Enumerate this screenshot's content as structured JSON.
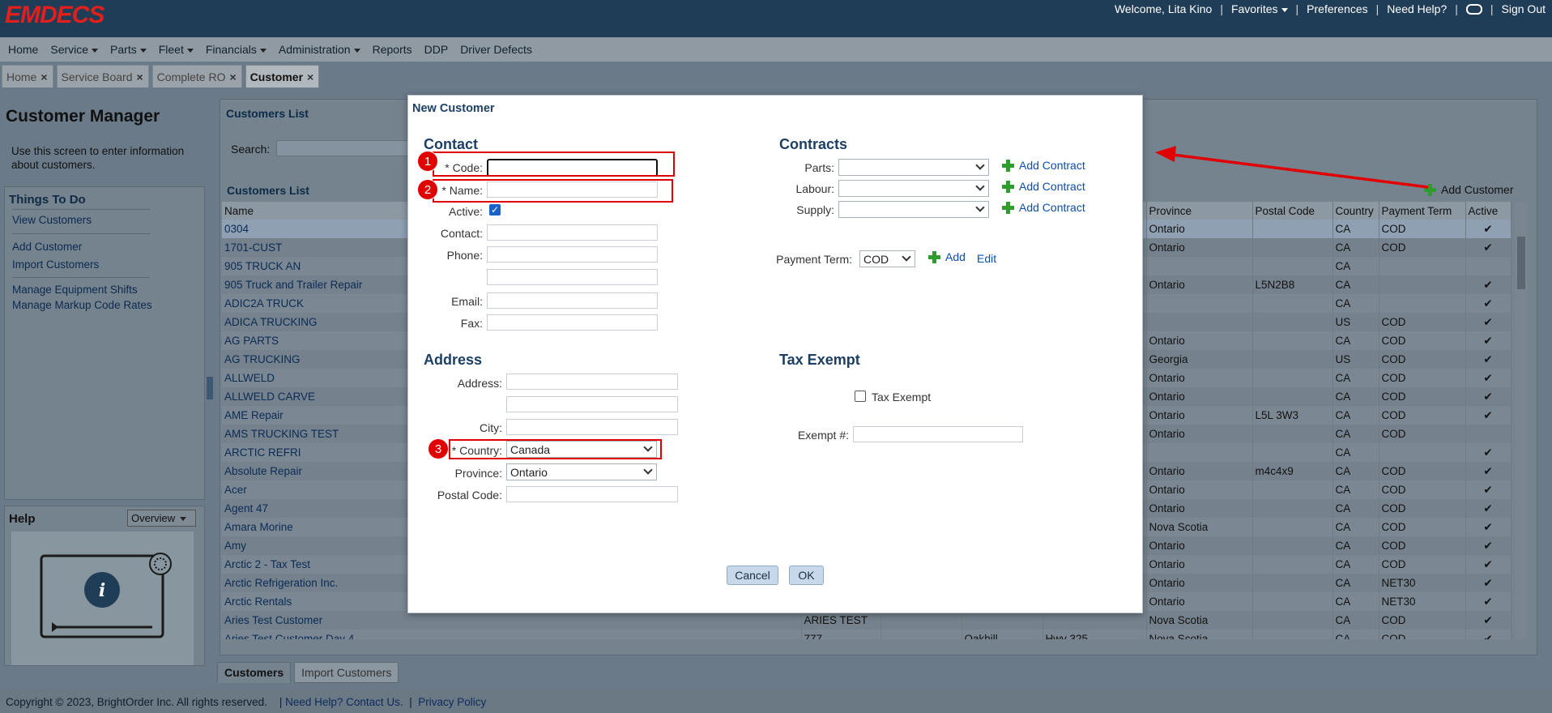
{
  "app": {
    "logo": "EMDECS"
  },
  "topbar": {
    "welcome": "Welcome, Lita Kino",
    "favorites": "Favorites",
    "preferences": "Preferences",
    "need_help": "Need Help?",
    "sign_out": "Sign Out"
  },
  "menu": [
    "Home",
    "Service",
    "Parts",
    "Fleet",
    "Financials",
    "Administration",
    "Reports",
    "DDP",
    "Driver Defects"
  ],
  "tabs": [
    {
      "label": "Home"
    },
    {
      "label": "Service Board"
    },
    {
      "label": "Complete RO"
    },
    {
      "label": "Customer",
      "active": true
    }
  ],
  "left": {
    "title": "Customer Manager",
    "description": "Use this screen to enter information about customers.",
    "things_title": "Things To Do",
    "links": [
      "View Customers",
      "Add Customer",
      "Import Customers",
      "Manage Equipment Shifts",
      "Manage Markup Code Rates"
    ],
    "help_title": "Help",
    "help_select": "Overview"
  },
  "list": {
    "title": "Customers List",
    "search_label": "Search:",
    "title2": "Customers List",
    "add_customer": "Add Customer",
    "columns": [
      "Name",
      "Province",
      "Postal Code",
      "Country",
      "Payment Term",
      "Active"
    ],
    "rows": [
      [
        "0304",
        "Ontario",
        "",
        "CA",
        "COD",
        "✔"
      ],
      [
        "1701-CUST",
        "Ontario",
        "",
        "CA",
        "COD",
        "✔"
      ],
      [
        "905 TRUCK AN",
        "",
        "",
        "CA",
        "",
        ""
      ],
      [
        "905 Truck and Trailer Repair",
        "Ontario",
        "L5N2B8",
        "CA",
        "",
        "✔"
      ],
      [
        "ADIC2A TRUCK",
        "",
        "",
        "CA",
        "",
        "✔"
      ],
      [
        "ADICA TRUCKING",
        "",
        "",
        "US",
        "COD",
        "✔"
      ],
      [
        "AG PARTS",
        "Ontario",
        "",
        "CA",
        "COD",
        "✔"
      ],
      [
        "AG TRUCKING",
        "Georgia",
        "",
        "US",
        "COD",
        "✔"
      ],
      [
        "ALLWELD",
        "Ontario",
        "",
        "CA",
        "COD",
        "✔"
      ],
      [
        "ALLWELD CARVE",
        "Ontario",
        "",
        "CA",
        "COD",
        "✔"
      ],
      [
        "AME Repair",
        "Ontario",
        "L5L 3W3",
        "CA",
        "COD",
        "✔"
      ],
      [
        "AMS TRUCKING TEST",
        "Ontario",
        "",
        "CA",
        "COD",
        ""
      ],
      [
        "ARCTIC REFRI",
        "",
        "",
        "CA",
        "",
        "✔"
      ],
      [
        "Absolute Repair",
        "Ontario",
        "m4c4x9",
        "CA",
        "COD",
        "✔"
      ],
      [
        "Acer",
        "Ontario",
        "",
        "CA",
        "COD",
        "✔"
      ],
      [
        "Agent 47",
        "Ontario",
        "",
        "CA",
        "COD",
        "✔"
      ],
      [
        "Amara Morine",
        "Nova Scotia",
        "",
        "CA",
        "COD",
        "✔"
      ],
      [
        "Amy",
        "Ontario",
        "",
        "CA",
        "COD",
        "✔"
      ],
      [
        "Arctic 2 - Tax Test",
        "Ontario",
        "",
        "CA",
        "COD",
        "✔"
      ],
      [
        "Arctic Refrigeration Inc.",
        "Ontario",
        "",
        "CA",
        "NET30",
        "✔"
      ],
      [
        "Arctic Rentals",
        "Ontario",
        "",
        "CA",
        "NET30",
        "✔"
      ],
      [
        "Aries Test Customer",
        "Nova Scotia",
        "",
        "CA",
        "COD",
        "✔"
      ],
      [
        "Aries Test Customer Day 4",
        "Nova Scotia",
        "",
        "CA",
        "COD",
        "✔"
      ]
    ],
    "row21_extra": "ARIES TEST",
    "row22_extra": [
      "777",
      "Oakhill",
      "Hwy 325"
    ]
  },
  "bottom_tabs": [
    "Customers",
    "Import Customers"
  ],
  "footer": {
    "copyright": "Copyright © 2023, BrightOrder Inc. All rights reserved.",
    "help": "Need Help? Contact Us.",
    "privacy": "Privacy Policy"
  },
  "dialog": {
    "title": "New Customer",
    "contact": {
      "heading": "Contact",
      "code_label": "* Code:",
      "name_label": "* Name:",
      "active_label": "Active:",
      "contact_label": "Contact:",
      "phone_label": "Phone:",
      "email_label": "Email:",
      "fax_label": "Fax:"
    },
    "contracts": {
      "heading": "Contracts",
      "parts_label": "Parts:",
      "labour_label": "Labour:",
      "supply_label": "Supply:",
      "add_contract": "Add Contract",
      "payment_term_label": "Payment Term:",
      "payment_term_value": "COD",
      "add": "Add",
      "edit": "Edit"
    },
    "address": {
      "heading": "Address",
      "address_label": "Address:",
      "city_label": "City:",
      "country_label": "* Country:",
      "country_value": "Canada",
      "province_label": "Province:",
      "province_value": "Ontario",
      "postal_label": "Postal Code:"
    },
    "tax": {
      "heading": "Tax Exempt",
      "checkbox_label": "Tax Exempt",
      "exempt_label": "Exempt #:"
    },
    "cancel": "Cancel",
    "ok": "OK"
  },
  "annotations": {
    "badge1": "1",
    "badge2": "2",
    "badge3": "3"
  },
  "colors": {
    "annotation": "#e00000",
    "topbar": "#1f3d56",
    "accent_green": "#2e9d2e",
    "link": "#0b4fa7"
  }
}
